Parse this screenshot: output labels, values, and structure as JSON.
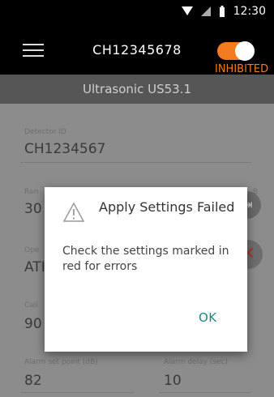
{
  "status": {
    "time": "12:30"
  },
  "appbar": {
    "title": "CH12345678",
    "toggle_state": "INHIBITED",
    "accent": "#f47b20"
  },
  "subheader": {
    "text": "Ultrasonic US53.1"
  },
  "form": {
    "detector_id": {
      "label": "Detector ID",
      "value": "CH1234567"
    },
    "range": {
      "label": "Ran",
      "value": "30"
    },
    "range_right_label": "B",
    "oper": {
      "label": "Ope",
      "value": "ATI"
    },
    "cali": {
      "label": "Cali",
      "value": "90"
    },
    "alarm_set_point": {
      "label": "Alarm set point (dB)",
      "value": "82"
    },
    "alarm_delay": {
      "label": "Alarm delay (sec)",
      "value": "10"
    }
  },
  "dialog": {
    "title": "Apply Settings Failed",
    "message": "Check the settings marked in red for errors",
    "ok": "OK",
    "icon": "warning-icon"
  },
  "colors": {
    "dialog_button": "#1a8a7a",
    "error_fab": "#b03030"
  }
}
